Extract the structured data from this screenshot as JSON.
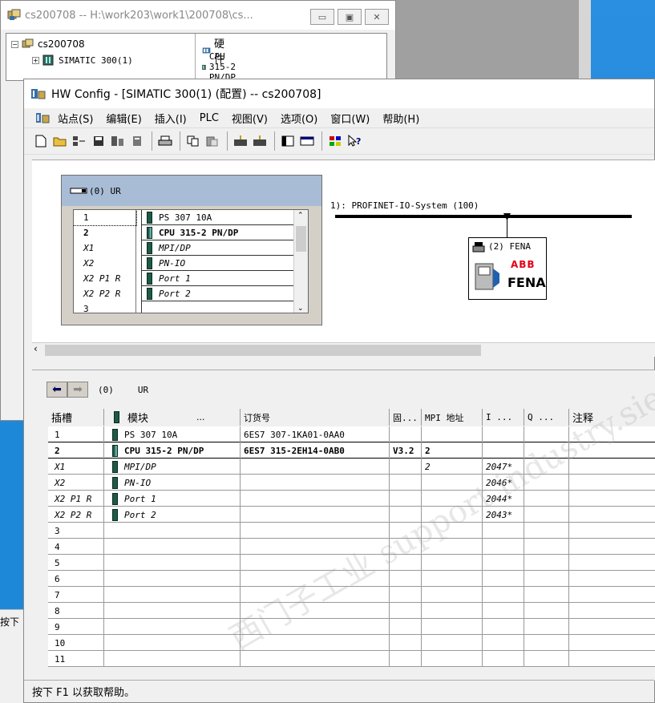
{
  "manager": {
    "title": "cs200708 -- H:\\work203\\work1\\200708\\cs...",
    "tree": [
      {
        "label": "cs200708"
      },
      {
        "label": "SIMATIC 300(1)"
      }
    ],
    "right_header": "硬件",
    "right_item": "CPU 315-2 PN/DP"
  },
  "hw": {
    "title": "HW Config - [SIMATIC 300(1) (配置) -- cs200708]",
    "menu": [
      "站点(S)",
      "编辑(E)",
      "插入(I)",
      "PLC",
      "视图(V)",
      "选项(O)",
      "窗口(W)",
      "帮助(H)"
    ],
    "rack_title": "(0) UR",
    "rack_rows": [
      {
        "slot": "1",
        "module": "PS 307 10A",
        "style": ""
      },
      {
        "slot": "2",
        "module": "CPU 315-2 PN/DP",
        "style": "bold"
      },
      {
        "slot": "X1",
        "module": "MPI/DP",
        "style": "it"
      },
      {
        "slot": "X2",
        "module": "PN-IO",
        "style": "it"
      },
      {
        "slot": "X2 P1 R",
        "module": "Port 1",
        "style": "it"
      },
      {
        "slot": "X2 P2 R",
        "module": "Port 2",
        "style": "it"
      },
      {
        "slot": "3",
        "module": "",
        "style": ""
      }
    ],
    "bus_label": "1): PROFINET-IO-System (100)",
    "device_name": "(2) FENA",
    "device_logo": "ABB",
    "device_text": "FENA",
    "detail_zero": "(0)",
    "detail_ur": "UR",
    "columns": [
      "插槽",
      "模块",
      "订货号",
      "固...",
      "MPI 地址",
      "I ...",
      "Q ...",
      "注释"
    ],
    "module_col_dots": "...",
    "rows": [
      {
        "slot": "1",
        "module": "PS 307 10A",
        "order": "6ES7 307-1KA01-0AA0",
        "fw": "",
        "mpi": "",
        "i": "",
        "q": "",
        "note": "",
        "style": "",
        "icon": "ps"
      },
      {
        "slot": "2",
        "module": "CPU 315-2 PN/DP",
        "order": "6ES7 315-2EH14-0AB0",
        "fw": "V3.2",
        "mpi": "2",
        "i": "",
        "q": "",
        "note": "",
        "style": "bold",
        "icon": "cpu"
      },
      {
        "slot": "X1",
        "module": "MPI/DP",
        "order": "",
        "fw": "",
        "mpi": "2",
        "i": "2047*",
        "q": "",
        "note": "",
        "style": "it",
        "icon": "sub"
      },
      {
        "slot": "X2",
        "module": "PN-IO",
        "order": "",
        "fw": "",
        "mpi": "",
        "i": "2046*",
        "q": "",
        "note": "",
        "style": "it",
        "icon": "sub"
      },
      {
        "slot": "X2 P1 R",
        "module": "Port 1",
        "order": "",
        "fw": "",
        "mpi": "",
        "i": "2044*",
        "q": "",
        "note": "",
        "style": "it",
        "icon": "sub"
      },
      {
        "slot": "X2 P2 R",
        "module": "Port 2",
        "order": "",
        "fw": "",
        "mpi": "",
        "i": "2043*",
        "q": "",
        "note": "",
        "style": "it",
        "icon": "sub"
      },
      {
        "slot": "3",
        "module": "",
        "order": "",
        "fw": "",
        "mpi": "",
        "i": "",
        "q": "",
        "note": "",
        "style": "",
        "icon": ""
      },
      {
        "slot": "4",
        "module": "",
        "order": "",
        "fw": "",
        "mpi": "",
        "i": "",
        "q": "",
        "note": "",
        "style": "",
        "icon": ""
      },
      {
        "slot": "5",
        "module": "",
        "order": "",
        "fw": "",
        "mpi": "",
        "i": "",
        "q": "",
        "note": "",
        "style": "",
        "icon": ""
      },
      {
        "slot": "6",
        "module": "",
        "order": "",
        "fw": "",
        "mpi": "",
        "i": "",
        "q": "",
        "note": "",
        "style": "",
        "icon": ""
      },
      {
        "slot": "7",
        "module": "",
        "order": "",
        "fw": "",
        "mpi": "",
        "i": "",
        "q": "",
        "note": "",
        "style": "",
        "icon": ""
      },
      {
        "slot": "8",
        "module": "",
        "order": "",
        "fw": "",
        "mpi": "",
        "i": "",
        "q": "",
        "note": "",
        "style": "",
        "icon": ""
      },
      {
        "slot": "9",
        "module": "",
        "order": "",
        "fw": "",
        "mpi": "",
        "i": "",
        "q": "",
        "note": "",
        "style": "",
        "icon": ""
      },
      {
        "slot": "10",
        "module": "",
        "order": "",
        "fw": "",
        "mpi": "",
        "i": "",
        "q": "",
        "note": "",
        "style": "",
        "icon": ""
      },
      {
        "slot": "11",
        "module": "",
        "order": "",
        "fw": "",
        "mpi": "",
        "i": "",
        "q": "",
        "note": "",
        "style": "",
        "icon": ""
      }
    ],
    "status": "按下 F1 以获取帮助。"
  },
  "desktop_fragment": "按下"
}
